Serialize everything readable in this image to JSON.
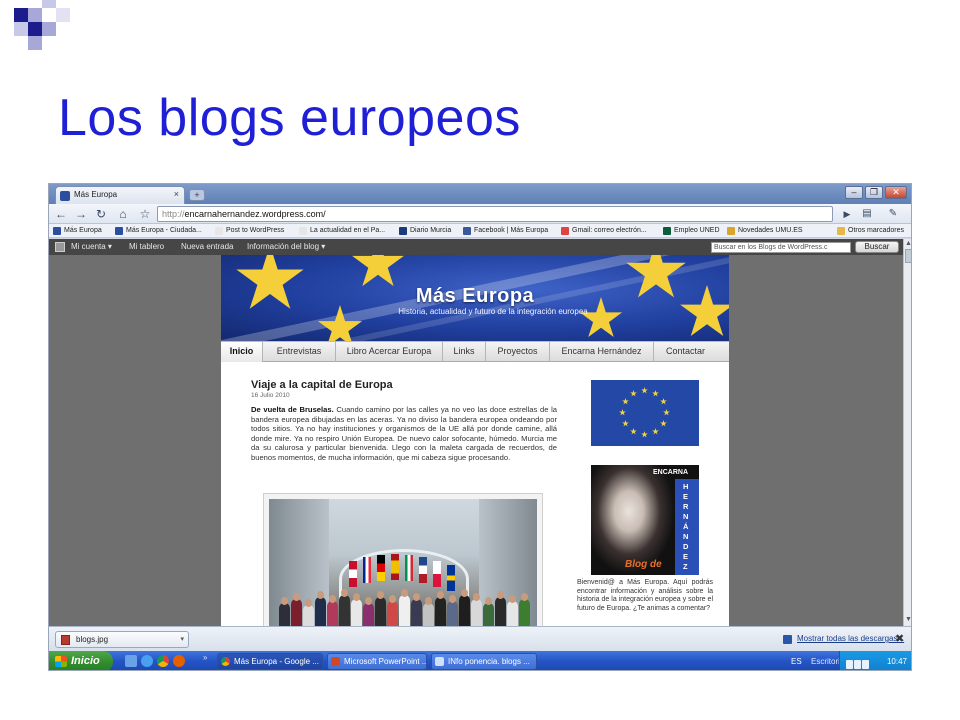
{
  "slide": {
    "title": "Los blogs europeos",
    "colors": {
      "title": "#1f1fd6",
      "decor_dark": "#1c1c8c",
      "decor_light": "#a8a8d8"
    }
  },
  "browser": {
    "tab_title": "Más Europa",
    "url_scheme": "http://",
    "url_host": "encarnahernandez.wordpress.com/",
    "bookmarks": [
      "Más Europa",
      "Más Europa - Ciudada...",
      "Post to WordPress",
      "La actualidad en el Pa...",
      "Diario Murcia",
      "Facebook | Más Europa",
      "Gmail: correo electrón...",
      "Empleo UNED",
      "Novedades UMU.ES",
      "Otros marcadores"
    ]
  },
  "admin_bar": {
    "items": [
      "Mi cuenta ▾",
      "Mi tablero",
      "Nueva entrada",
      "Información del blog ▾"
    ],
    "search_placeholder": "Buscar en los Blogs de WordPress.c",
    "search_button": "Buscar"
  },
  "blog": {
    "title": "Más Europa",
    "tagline": "Historia, actualidad y futuro de la integración europea",
    "menu": [
      "Inicio",
      "Entrevistas",
      "Libro Acercar Europa",
      "Links",
      "Proyectos",
      "Encarna Hernández",
      "Contactar"
    ],
    "active_menu": "Inicio",
    "post": {
      "title": "Viaje a la capital de Europa",
      "date": "16 Julio 2010",
      "lead": "De vuelta de Bruselas.",
      "body": "Cuando camino por las calles ya no veo las doce estrellas de la bandera europea dibujadas en las aceras. Ya no diviso la bandera europea ondeando por todos sitios. Ya no hay instituciones y organismos de la UE allá por donde camine, allá donde mire. Ya no respiro Unión Europea. De nuevo calor sofocante, húmedo. Murcia me da su calurosa y particular bienvenida. Llego con la maleta cargada de recuerdos, de buenos momentos, de mucha información, que mi cabeza sigue procesando."
    },
    "portrait": {
      "top_label": "ENCARNA",
      "vertical": [
        "H",
        "E",
        "R",
        "N",
        "Á",
        "N",
        "D",
        "E",
        "Z"
      ],
      "footer": "Blog de"
    },
    "sidebar_text": "Bienvenid@ a Más Europa. Aquí podrás encontrar información y análisis sobre la historia de la integración europea y sobre el futuro de Europa. ¿Te animas a comentar?"
  },
  "downloads": {
    "file": "blogs.jpg",
    "show_all": "Mostrar todas las descargas...",
    "close": "✖"
  },
  "taskbar": {
    "start": "Inicio",
    "tasks": [
      "Más Europa - Google ...",
      "Microsoft PowerPoint ...",
      "INfo ponencia. blogs ..."
    ],
    "lang": "ES",
    "desktop": "Escritorio",
    "clock": "10:47"
  }
}
